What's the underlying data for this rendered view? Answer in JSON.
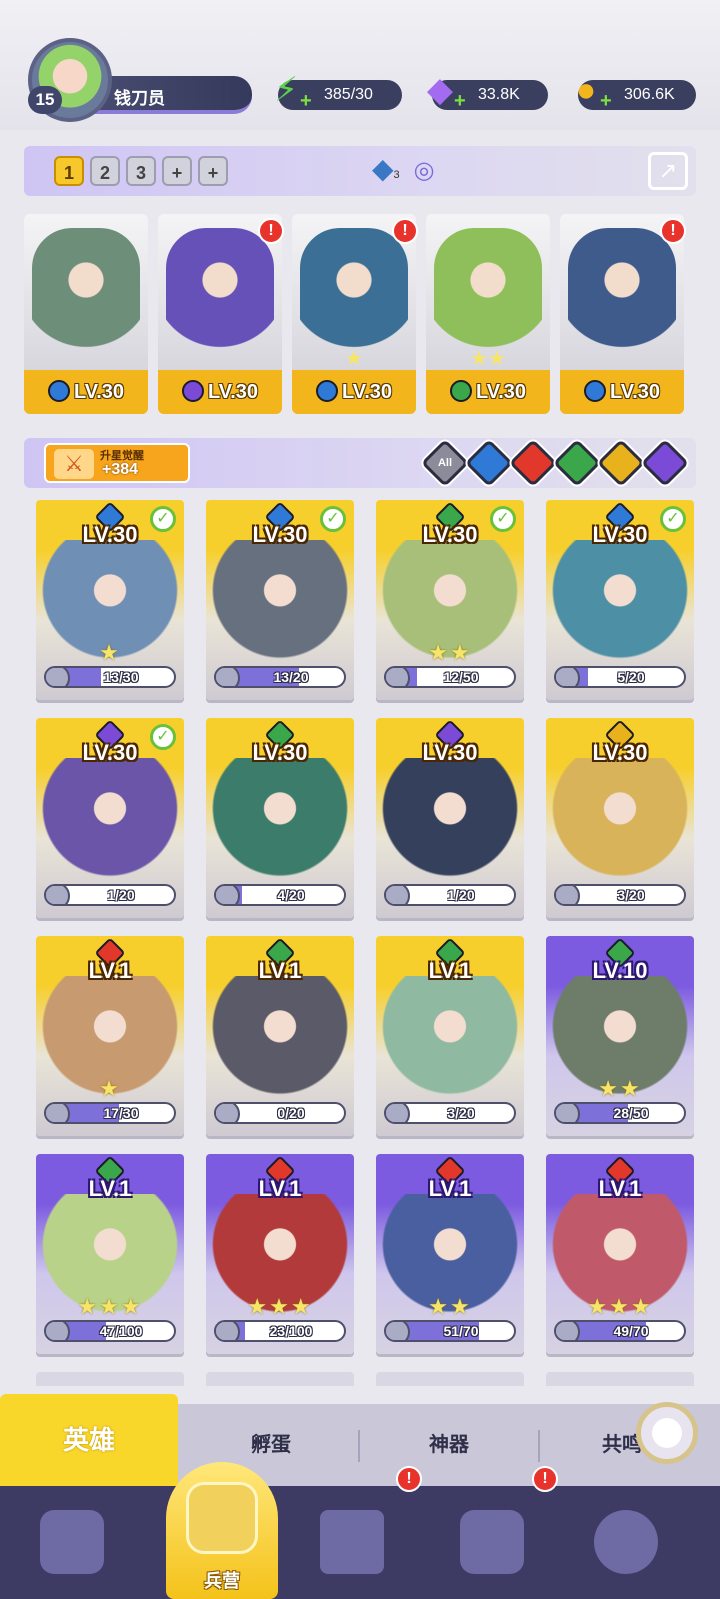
{
  "profile": {
    "level": "15",
    "name": "钱刀员"
  },
  "resources": [
    {
      "icon": "energy-icon",
      "value": "385/30",
      "color": "#5cd34a",
      "glyph": "⚡"
    },
    {
      "icon": "gem-icon",
      "value": "33.8K",
      "color": "#a36bf0",
      "glyph": "◆"
    },
    {
      "icon": "coin-icon",
      "value": "306.6K",
      "color": "#f2b51c",
      "glyph": "●"
    }
  ],
  "team_tabs": [
    "1",
    "2",
    "3",
    "+",
    "+"
  ],
  "team_badge": "3",
  "team_heroes": [
    {
      "level": "LV.30",
      "element": "water",
      "color": "#2f7ad6",
      "art": "#6d8f7a",
      "alert": false,
      "stars": ""
    },
    {
      "level": "LV.30",
      "element": "dark",
      "color": "#7b4ad6",
      "art": "#6651b8",
      "alert": true,
      "stars": ""
    },
    {
      "level": "LV.30",
      "element": "water",
      "color": "#2f7ad6",
      "art": "#3c6f95",
      "alert": true,
      "stars": "★"
    },
    {
      "level": "LV.30",
      "element": "wind",
      "color": "#3aa84a",
      "art": "#8fbf5a",
      "alert": false,
      "stars": "★★"
    },
    {
      "level": "LV.30",
      "element": "water",
      "color": "#2f7ad6",
      "art": "#3e5b8c",
      "alert": true,
      "stars": ""
    }
  ],
  "awaken": {
    "label": "升星觉醒",
    "value": "+384"
  },
  "filters": [
    {
      "name": "all",
      "label": "All",
      "color": "#8b8b9a"
    },
    {
      "name": "water",
      "label": "",
      "color": "#2f7ad6"
    },
    {
      "name": "fire",
      "label": "",
      "color": "#e2382b"
    },
    {
      "name": "wind",
      "label": "",
      "color": "#3aa84a"
    },
    {
      "name": "light",
      "label": "",
      "color": "#e8b21c"
    },
    {
      "name": "dark",
      "label": "",
      "color": "#7b4ad6"
    }
  ],
  "heroes": [
    {
      "level": "LV.30",
      "shards": "13/30",
      "progress": 0.43,
      "style": "gold",
      "element_color": "#2f7ad6",
      "art": "#6f8fb5",
      "checked": true,
      "stars": "★"
    },
    {
      "level": "LV.30",
      "shards": "13/20",
      "progress": 0.65,
      "style": "gold",
      "element_color": "#2f7ad6",
      "art": "#66707e",
      "checked": true,
      "stars": ""
    },
    {
      "level": "LV.30",
      "shards": "12/50",
      "progress": 0.24,
      "style": "gold",
      "element_color": "#3aa84a",
      "art": "#a8bf7a",
      "checked": true,
      "stars": "★★"
    },
    {
      "level": "LV.30",
      "shards": "5/20",
      "progress": 0.25,
      "style": "gold",
      "element_color": "#2f7ad6",
      "art": "#4d8fa5",
      "checked": true,
      "stars": ""
    },
    {
      "level": "LV.30",
      "shards": "1/20",
      "progress": 0.05,
      "style": "gold",
      "element_color": "#7b4ad6",
      "art": "#6a55a8",
      "checked": true,
      "stars": ""
    },
    {
      "level": "LV.30",
      "shards": "4/20",
      "progress": 0.2,
      "style": "gold",
      "element_color": "#3aa84a",
      "art": "#3c7c6a",
      "checked": false,
      "stars": ""
    },
    {
      "level": "LV.30",
      "shards": "1/20",
      "progress": 0.05,
      "style": "gold",
      "element_color": "#7b4ad6",
      "art": "#35405c",
      "checked": false,
      "stars": ""
    },
    {
      "level": "LV.30",
      "shards": "3/20",
      "progress": 0.15,
      "style": "gold",
      "element_color": "#e8b21c",
      "art": "#d8b35a",
      "checked": false,
      "stars": ""
    },
    {
      "level": "LV.1",
      "shards": "17/30",
      "progress": 0.57,
      "style": "gold",
      "element_color": "#e2382b",
      "art": "#c79a6f",
      "checked": false,
      "stars": "★"
    },
    {
      "level": "LV.1",
      "shards": "0/20",
      "progress": 0.0,
      "style": "gold",
      "element_color": "#3aa84a",
      "art": "#5a5a68",
      "checked": false,
      "stars": ""
    },
    {
      "level": "LV.1",
      "shards": "3/20",
      "progress": 0.15,
      "style": "gold",
      "element_color": "#3aa84a",
      "art": "#8fb9a0",
      "checked": false,
      "stars": ""
    },
    {
      "level": "LV.10",
      "shards": "28/50",
      "progress": 0.56,
      "style": "purple",
      "element_color": "#3aa84a",
      "art": "#6e7c6a",
      "checked": false,
      "stars": "★★"
    },
    {
      "level": "LV.1",
      "shards": "47/100",
      "progress": 0.47,
      "style": "purple",
      "element_color": "#3aa84a",
      "art": "#b8d28a",
      "checked": false,
      "stars": "★★★"
    },
    {
      "level": "LV.1",
      "shards": "23/100",
      "progress": 0.23,
      "style": "purple",
      "element_color": "#e2382b",
      "art": "#b23a3a",
      "checked": false,
      "stars": "★★★"
    },
    {
      "level": "LV.1",
      "shards": "51/70",
      "progress": 0.73,
      "style": "purple",
      "element_color": "#e2382b",
      "art": "#4a5fa0",
      "checked": false,
      "stars": "★★"
    },
    {
      "level": "LV.1",
      "shards": "49/70",
      "progress": 0.7,
      "style": "purple",
      "element_color": "#e2382b",
      "art": "#c05a6a",
      "checked": false,
      "stars": "★★★"
    }
  ],
  "sub_tabs": [
    "英雄",
    "孵蛋",
    "神器",
    "共鸣"
  ],
  "bottom_nav": [
    {
      "name": "cards",
      "label": "",
      "alert": false
    },
    {
      "name": "barracks",
      "label": "兵营",
      "alert": false
    },
    {
      "name": "map",
      "label": "",
      "alert": true
    },
    {
      "name": "castle",
      "label": "",
      "alert": true
    },
    {
      "name": "mushroom",
      "label": "",
      "alert": false
    }
  ]
}
